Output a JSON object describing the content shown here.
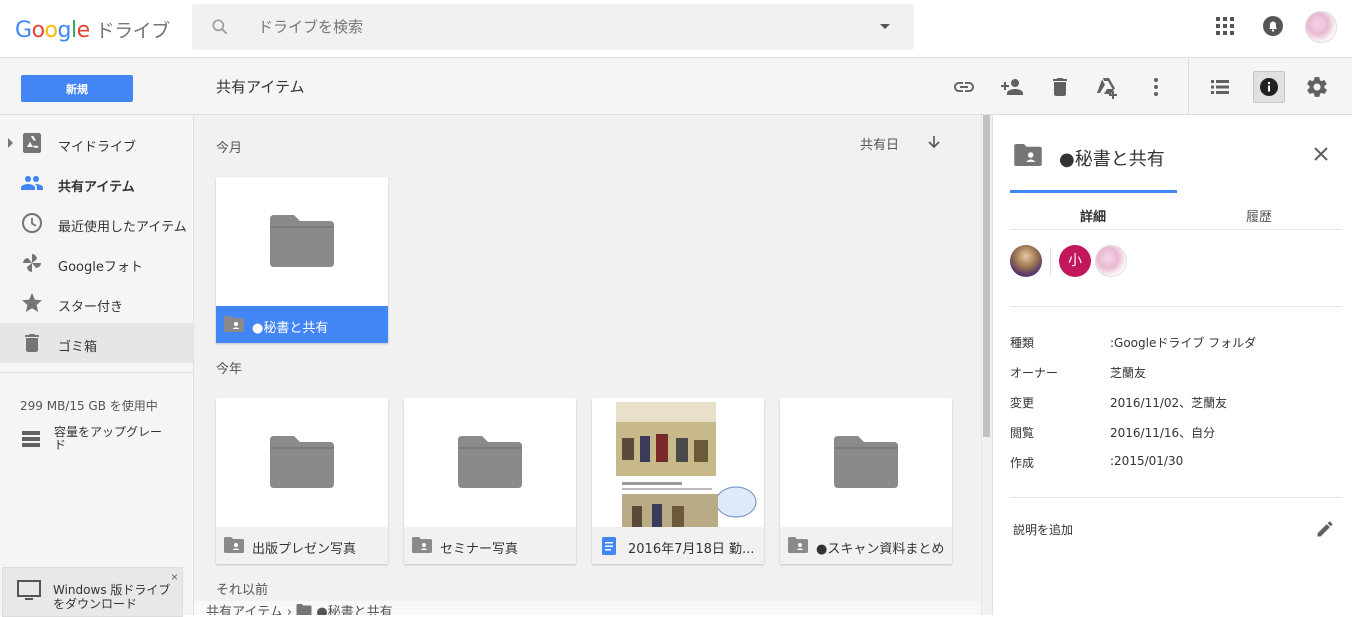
{
  "header": {
    "logo_letters": [
      "G",
      "o",
      "o",
      "g",
      "l",
      "e"
    ],
    "product": "ドライブ",
    "search_placeholder": "ドライブを検索"
  },
  "toolbar": {
    "new_label": "新規",
    "title": "共有アイテム"
  },
  "sidebar": {
    "items": [
      {
        "label": "マイドライブ",
        "icon": "drive-icon"
      },
      {
        "label": "共有アイテム",
        "icon": "people-icon",
        "active": true
      },
      {
        "label": "最近使用したアイテム",
        "icon": "clock-icon"
      },
      {
        "label": "Googleフォト",
        "icon": "pinwheel-icon"
      },
      {
        "label": "スター付き",
        "icon": "star-icon"
      },
      {
        "label": "ゴミ箱",
        "icon": "trash-icon"
      }
    ],
    "storage": "299 MB/15 GB を使用中",
    "upgrade": "容量をアップグレード",
    "download": "Windows 版ドライブをダウンロード",
    "download_close": "×"
  },
  "main": {
    "sections": {
      "this_month": "今月",
      "this_year": "今年",
      "older": "それ以前"
    },
    "sort_label": "共有日",
    "cards": [
      {
        "name": "●秘書と共有",
        "type": "shared-folder",
        "selected": true
      },
      {
        "name": "出版プレゼン写真",
        "type": "shared-folder"
      },
      {
        "name": "セミナー写真",
        "type": "shared-folder"
      },
      {
        "name": "2016年7月18日 勤...",
        "type": "document"
      },
      {
        "name": "●スキャン資料まとめ",
        "type": "shared-folder"
      }
    ],
    "breadcrumb": {
      "root": "共有アイテム",
      "sep": "›",
      "current": "●秘書と共有"
    }
  },
  "panel": {
    "title": "●秘書と共有",
    "tabs": [
      "詳細",
      "履歴"
    ],
    "sharer_initial": "小",
    "colors": {
      "accent": "#4285f4",
      "sharer": "#c2185b"
    },
    "properties": [
      {
        "key": "種類",
        "value": ":Googleドライブ フォルダ"
      },
      {
        "key": "オーナー",
        "value": "芝蘭友"
      },
      {
        "key": "変更",
        "value": "2016/11/02、芝蘭友"
      },
      {
        "key": "閲覧",
        "value": "2016/11/16、自分"
      },
      {
        "key": "作成",
        "value": ":2015/01/30"
      }
    ],
    "description": "説明を追加"
  }
}
